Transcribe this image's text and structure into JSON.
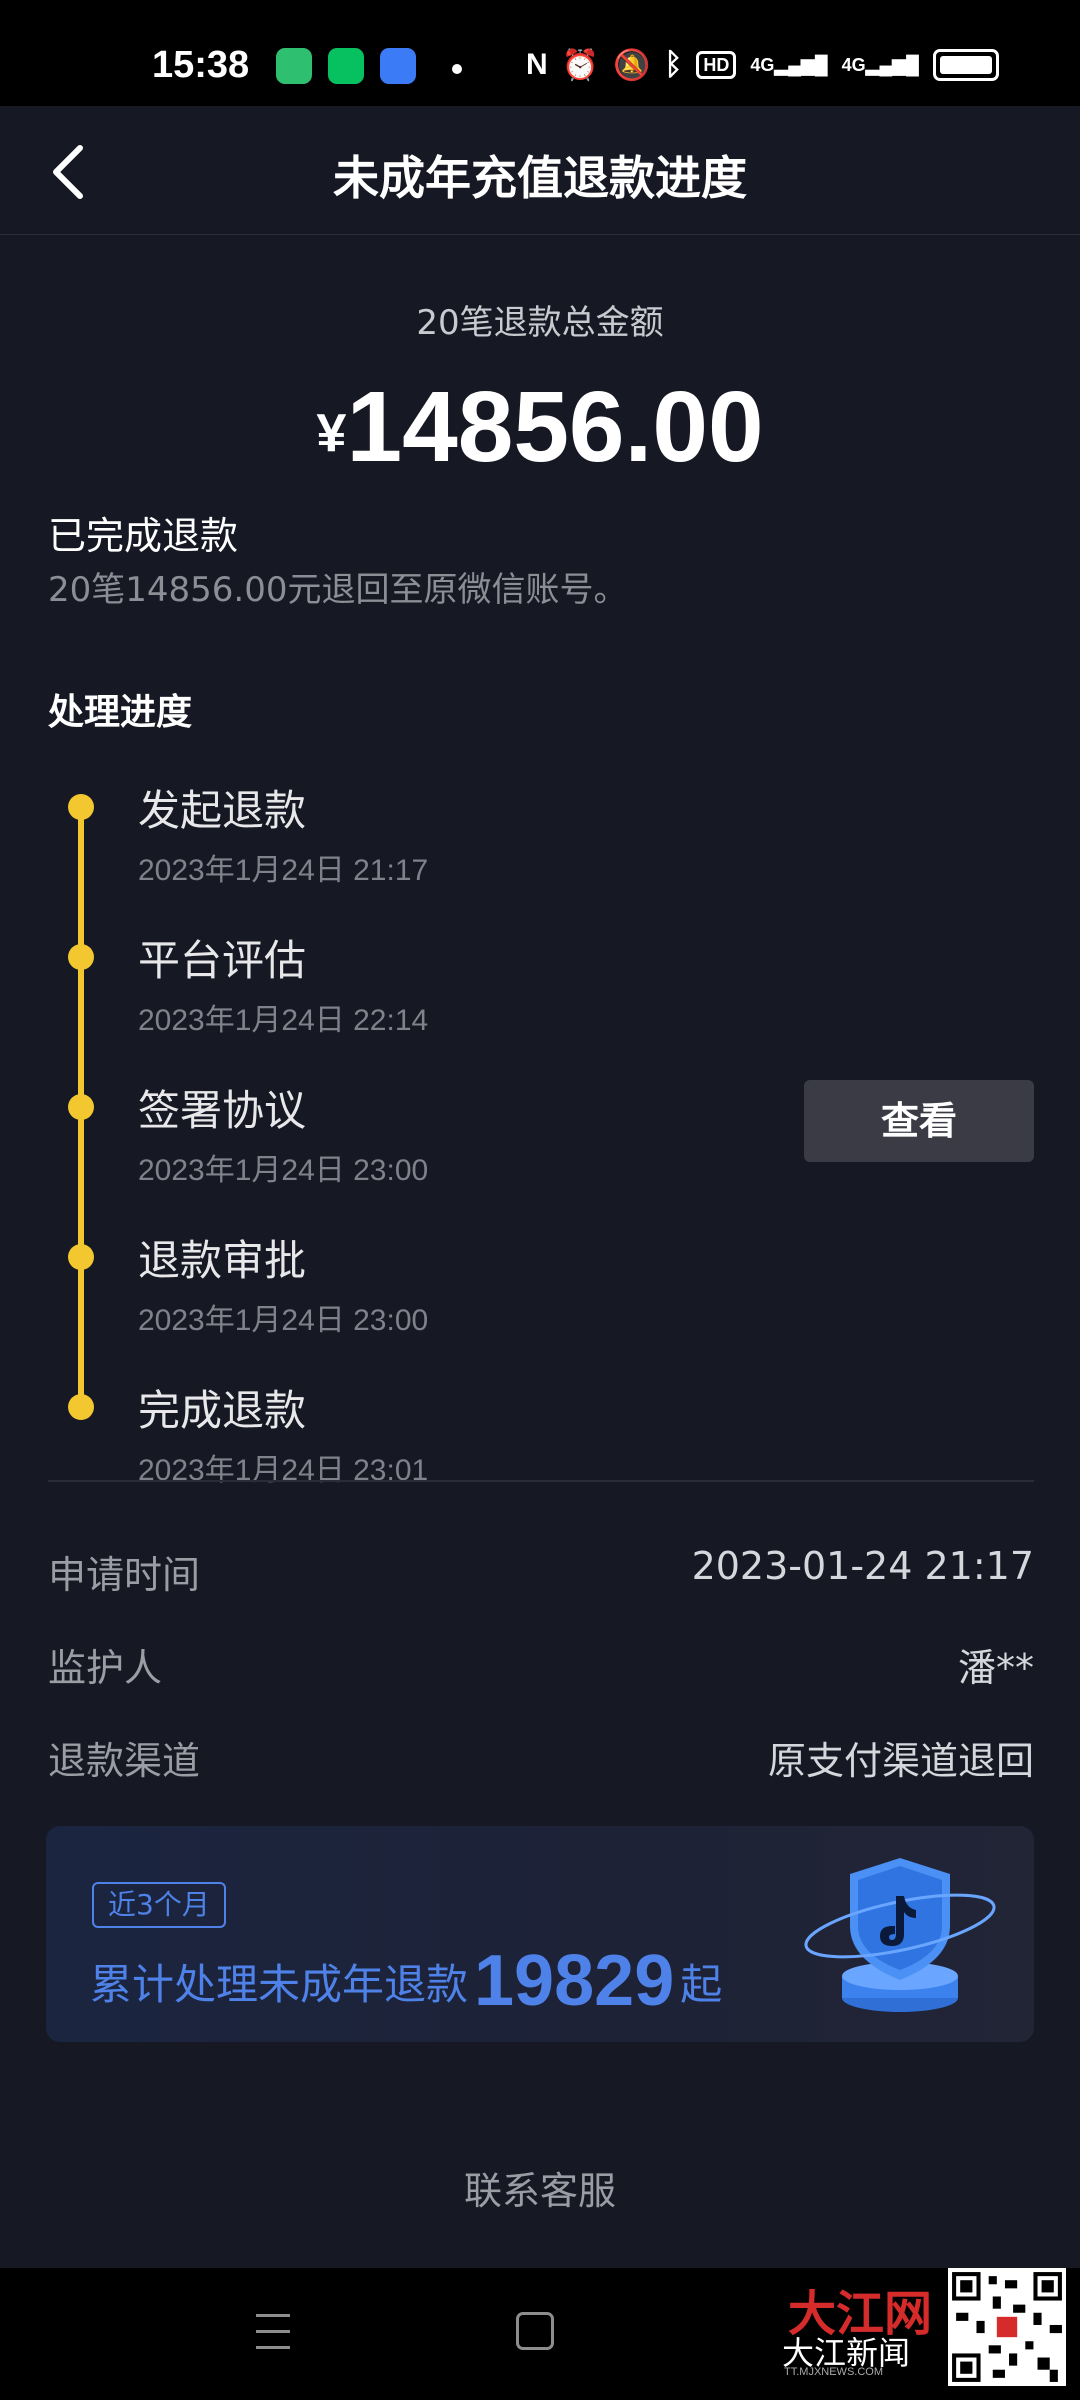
{
  "status_bar": {
    "time": "15:38",
    "app_icon_colors": [
      "#2fbf71",
      "#07c160",
      "#3b7cf6"
    ],
    "icons": [
      "nfc-icon",
      "alarm-icon",
      "mute-icon",
      "bluetooth-icon"
    ],
    "hd_badge": "HD",
    "signal_1": "4G",
    "signal_2": "4G"
  },
  "header": {
    "title": "未成年充值退款进度"
  },
  "summary": {
    "total_label": "20笔退款总金额",
    "currency": "¥",
    "amount": "14856.00",
    "done_title": "已完成退款",
    "done_desc": "20笔14856.00元退回至原微信账号。"
  },
  "progress": {
    "section_title": "处理进度",
    "accent_color": "#f2c730",
    "steps": [
      {
        "title": "发起退款",
        "time": "2023年1月24日 21:17"
      },
      {
        "title": "平台评估",
        "time": "2023年1月24日 22:14"
      },
      {
        "title": "签署协议",
        "time": "2023年1月24日 23:00"
      },
      {
        "title": "退款审批",
        "time": "2023年1月24日 23:00"
      },
      {
        "title": "完成退款",
        "time": "2023年1月24日 23:01"
      }
    ],
    "view_button": "查看"
  },
  "info": {
    "rows": [
      {
        "label": "申请时间",
        "value": "2023-01-24 21:17"
      },
      {
        "label": "监护人",
        "value": "潘**"
      },
      {
        "label": "退款渠道",
        "value": "原支付渠道退回"
      }
    ]
  },
  "banner": {
    "tag": "近3个月",
    "text_before": "累计处理未成年退款",
    "count": "19829",
    "text_after": "起",
    "accent_color": "#4f82e8"
  },
  "footer": {
    "contact": "联系客服"
  },
  "watermark": {
    "brand_top": "大江网",
    "brand_bottom": "大江新闻",
    "url": "TT.MJXNEWS.COM"
  }
}
